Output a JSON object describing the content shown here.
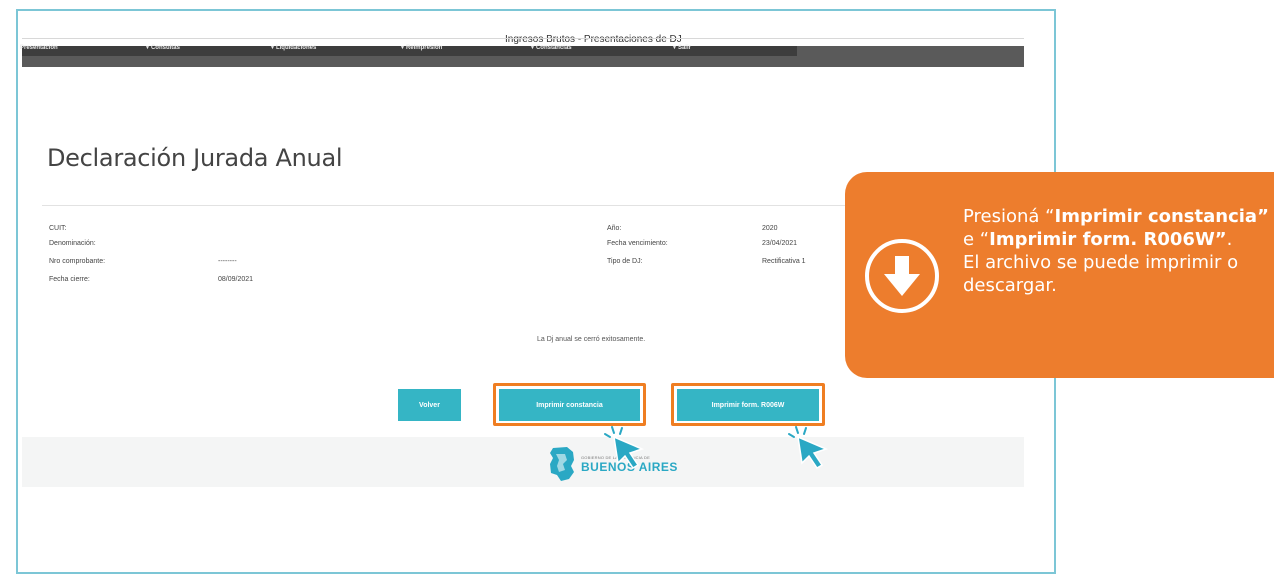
{
  "app": {
    "title": "Ingresos Brutos - Presentaciones de DJ"
  },
  "menu": {
    "items": [
      {
        "label": "Presentación",
        "arrow": false
      },
      {
        "label": "Consultas",
        "arrow": true
      },
      {
        "label": "Liquidaciones",
        "arrow": true
      },
      {
        "label": "Reimpresión",
        "arrow": true
      },
      {
        "label": "Constancias",
        "arrow": true
      },
      {
        "label": "Salir",
        "arrow": true
      }
    ]
  },
  "page": {
    "heading": "Declaración Jurada Anual"
  },
  "fields": {
    "cuit": {
      "label": "CUIT:",
      "value": ""
    },
    "denominacion": {
      "label": "Denominación:",
      "value": ""
    },
    "nro_comprobante": {
      "label": "Nro comprobante:",
      "value": "--------"
    },
    "fecha_cierre": {
      "label": "Fecha cierre:",
      "value": "08/09/2021"
    },
    "anio": {
      "label": "Año:",
      "value": "2020"
    },
    "fecha_vencimiento": {
      "label": "Fecha vencimiento:",
      "value": "23/04/2021"
    },
    "tipo_dj": {
      "label": "Tipo de DJ:",
      "value": "Rectificativa 1"
    }
  },
  "message": "La Dj anual se cerró exitosamente.",
  "buttons": {
    "volver": "Volver",
    "imprimir_constancia": "Imprimir constancia",
    "imprimir_form": "Imprimir form. R006W"
  },
  "footer": {
    "logo_small": "GOBIERNO DE LA PROVINCIA DE",
    "logo_big": "BUENOS AIRES"
  },
  "callout": {
    "p1": "Presioná “",
    "b1": "Imprimir constancia”",
    "p2": " e “",
    "b2": "Imprimir form. R006W”",
    "p3": ".",
    "line2": "El archivo se puede imprimir o descargar."
  },
  "colors": {
    "accent": "#35b5c5",
    "highlight": "#ef7e22",
    "callout": "#ed7d2d",
    "frame": "#7cc6d6"
  },
  "icons": {
    "callout": "download-arrow-icon",
    "pointer": "cursor-pointer-icon"
  }
}
